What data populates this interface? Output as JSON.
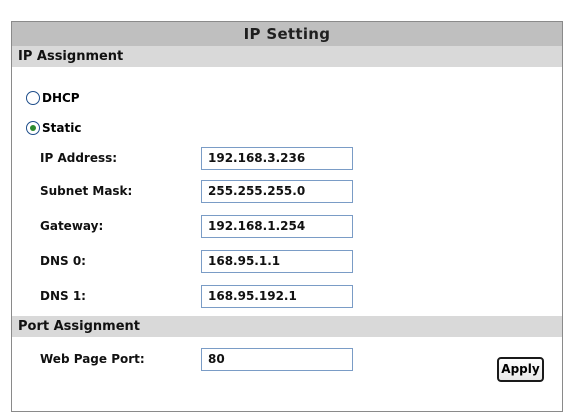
{
  "title": "IP Setting",
  "sections": {
    "ip_assignment": "IP Assignment",
    "port_assignment": "Port Assignment"
  },
  "radios": {
    "dhcp": {
      "label": "DHCP",
      "selected": false
    },
    "static": {
      "label": "Static",
      "selected": true
    }
  },
  "fields": {
    "ip_address": {
      "label": "IP Address:",
      "value": "192.168.3.236"
    },
    "subnet_mask": {
      "label": "Subnet Mask:",
      "value": "255.255.255.0"
    },
    "gateway": {
      "label": "Gateway:",
      "value": "192.168.1.254"
    },
    "dns0": {
      "label": "DNS 0:",
      "value": "168.95.1.1"
    },
    "dns1": {
      "label": "DNS 1:",
      "value": "168.95.192.1"
    },
    "web_port": {
      "label": "Web Page Port:",
      "value": "80"
    }
  },
  "buttons": {
    "apply": "Apply"
  },
  "colors": {
    "title_bg": "#bfbfbf",
    "section_bg": "#d9d9d9",
    "input_border": "#7a9cc6",
    "radio_selected": "#2e8b2e"
  }
}
